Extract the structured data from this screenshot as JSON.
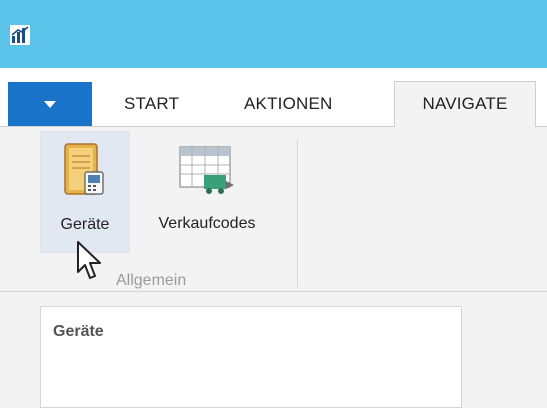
{
  "tabs": {
    "start": "START",
    "aktionen": "AKTIONEN",
    "navigate": "NAVIGATE"
  },
  "ribbon": {
    "geraete_label": "Geräte",
    "verkaufcodes_label": "Verkaufcodes",
    "group_label": "Allgemein"
  },
  "content": {
    "panel_title": "Geräte"
  },
  "colors": {
    "titlebar": "#5cc3ea",
    "app_menu": "#1873c9",
    "selected_button": "#e1e8f1"
  },
  "icons": {
    "app": "app-logo-icon",
    "geraete": "notebook-device-icon",
    "verkaufcodes": "price-list-grid-icon",
    "cursor": "mouse-pointer-icon"
  }
}
